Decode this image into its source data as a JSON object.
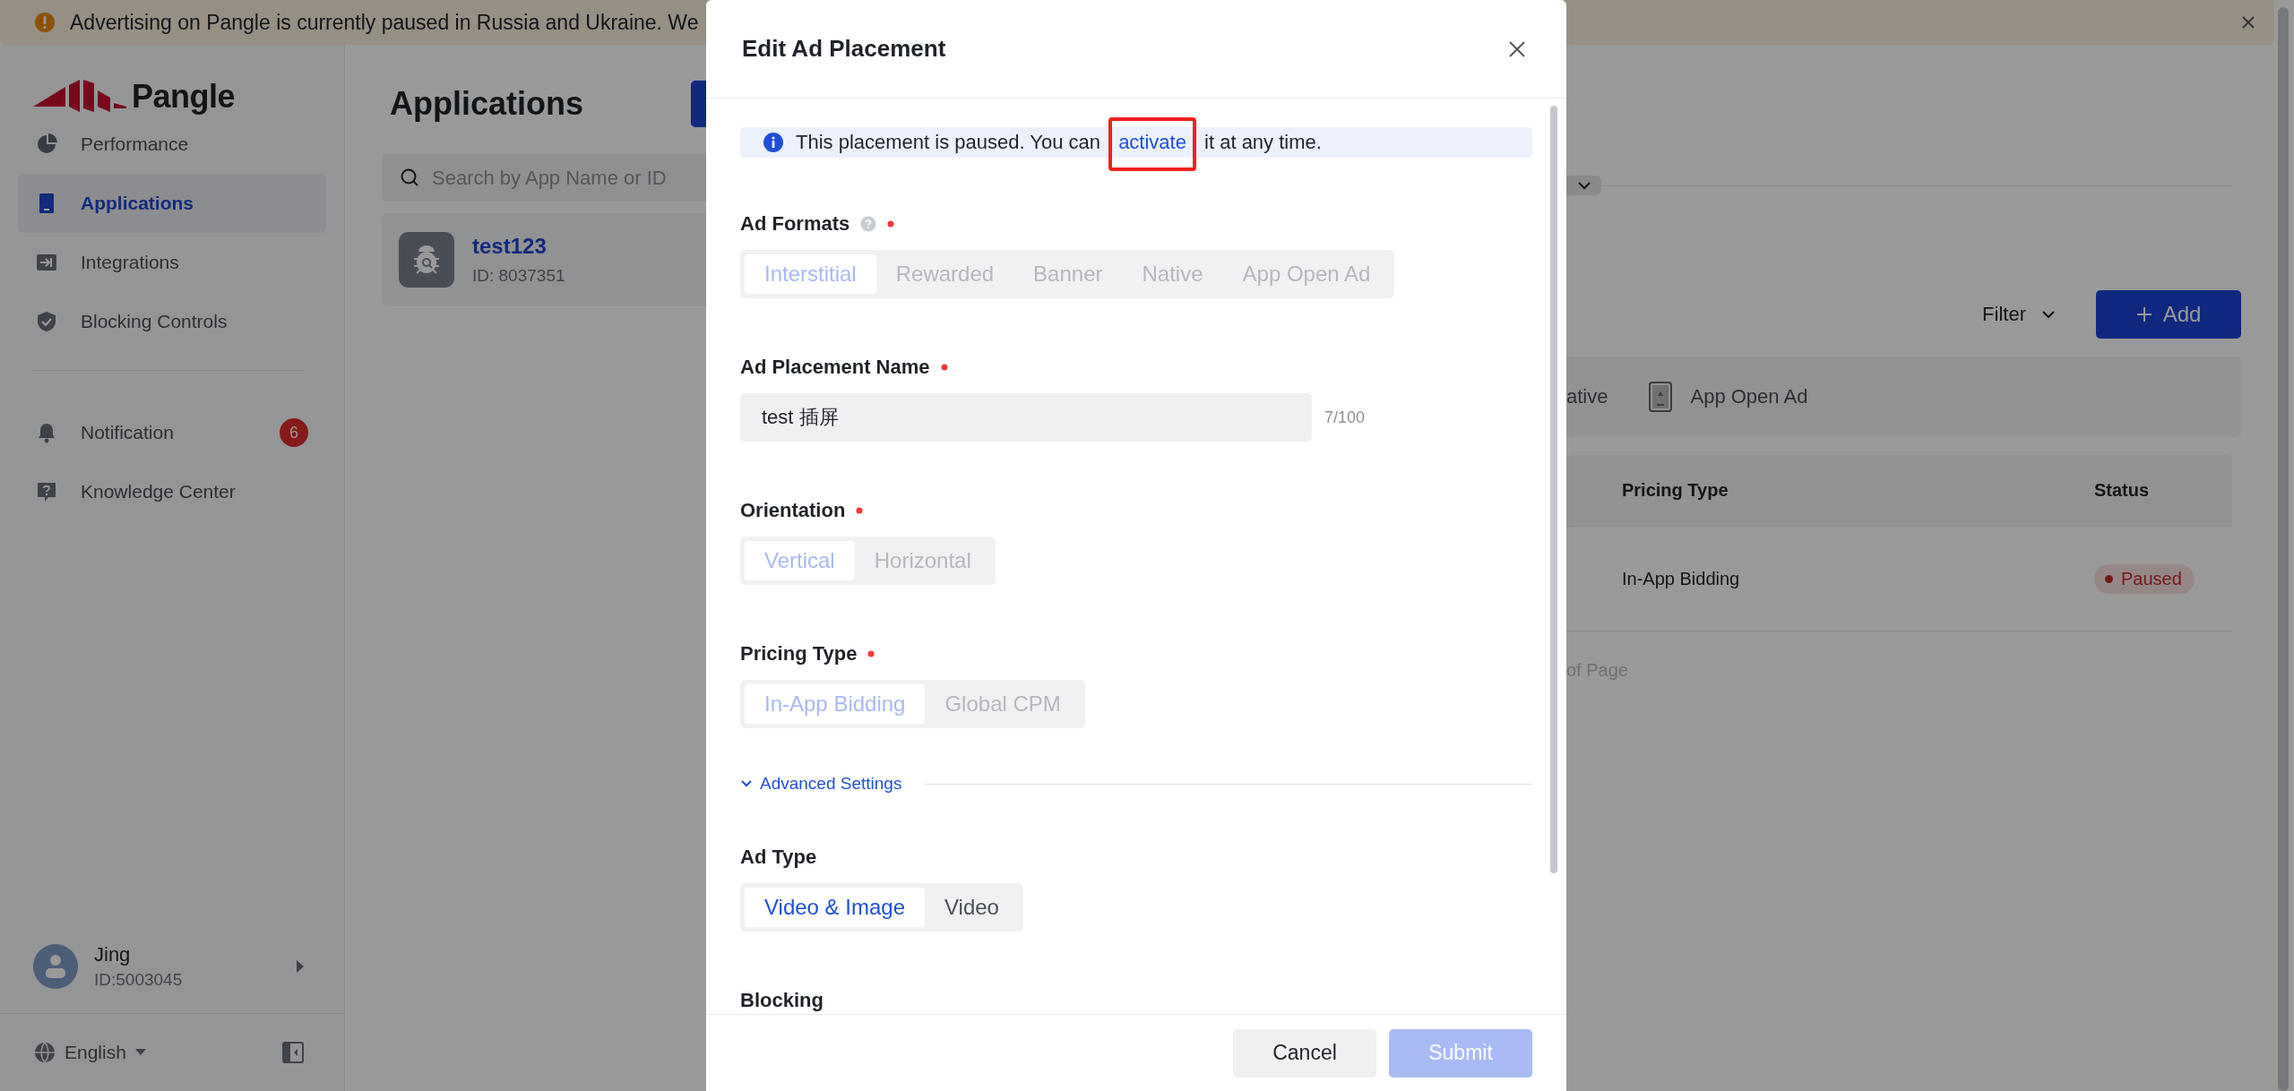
{
  "banner": {
    "text": "Advertising on Pangle is currently paused in Russia and Ukraine. We"
  },
  "sidebar": {
    "logo": "Pangle",
    "nav": [
      {
        "label": "Performance",
        "selected": false
      },
      {
        "label": "Applications",
        "selected": true
      },
      {
        "label": "Integrations",
        "selected": false
      },
      {
        "label": "Blocking Controls",
        "selected": false
      }
    ],
    "nav_secondary": [
      {
        "label": "Notification",
        "selected": false,
        "badge": "6"
      },
      {
        "label": "Knowledge Center",
        "selected": false
      }
    ],
    "user": {
      "name": "Jing",
      "id": "ID:5003045"
    },
    "language": "English"
  },
  "main": {
    "title": "Applications",
    "search": {
      "placeholder": "Search by App Name or ID"
    },
    "apps": [
      {
        "name": "test123",
        "id": "ID: 8037351"
      }
    ],
    "filter": "Filter",
    "add_button": "Add",
    "format_tabs": [
      "ative",
      "App Open Ad"
    ],
    "table": {
      "columns": [
        "Pricing Type",
        "Status"
      ],
      "rows": [
        {
          "pricing_type": "In-App Bidding",
          "status": {
            "label": "Paused",
            "kind": "paused"
          }
        }
      ]
    },
    "footer_text": "of Page"
  },
  "modal": {
    "title": "Edit Ad Placement",
    "alert": {
      "before": "This placement is paused. You can ",
      "link": "activate",
      "link_highlighted": true,
      "after": " it at any time."
    },
    "items": [
      {
        "kind": "segmented",
        "label": "Ad Formats",
        "help": true,
        "required": true,
        "disabled": true,
        "options": [
          {
            "label": "Interstitial",
            "selected": true
          },
          {
            "label": "Rewarded",
            "selected": false
          },
          {
            "label": "Banner",
            "selected": false
          },
          {
            "label": "Native",
            "selected": false
          },
          {
            "label": "App Open Ad",
            "selected": false
          }
        ]
      },
      {
        "kind": "text",
        "label": "Ad Placement Name",
        "required": true,
        "value": "test 插屏",
        "counter": "7/100"
      },
      {
        "kind": "segmented",
        "label": "Orientation",
        "required": true,
        "disabled": true,
        "options": [
          {
            "label": "Vertical",
            "selected": true
          },
          {
            "label": "Horizontal",
            "selected": false
          }
        ]
      },
      {
        "kind": "segmented",
        "label": "Pricing Type",
        "required": true,
        "disabled": true,
        "options": [
          {
            "label": "In-App Bidding",
            "selected": true
          },
          {
            "label": "Global CPM",
            "selected": false
          }
        ]
      },
      {
        "kind": "toggle",
        "label": "Advanced Settings",
        "expanded": true
      },
      {
        "kind": "segmented",
        "label": "Ad Type",
        "required": false,
        "disabled": false,
        "options": [
          {
            "label": "Video & Image",
            "selected": true
          },
          {
            "label": "Video",
            "selected": false
          }
        ]
      },
      {
        "kind": "heading",
        "label": "Blocking"
      }
    ],
    "cancel": "Cancel",
    "submit": {
      "label": "Submit",
      "disabled": true
    }
  }
}
